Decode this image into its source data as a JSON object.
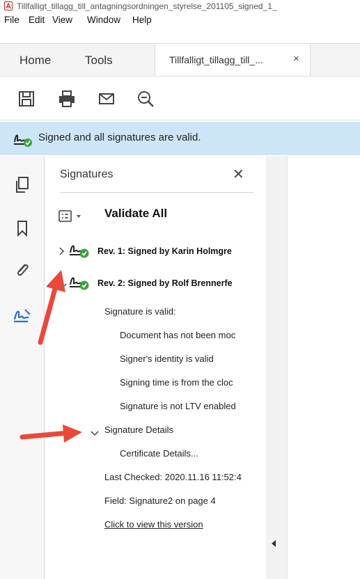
{
  "window": {
    "title": "Tillfalligt_tillagg_till_antagningsordningen_styrelse_201105_signed_1_"
  },
  "menu": [
    "File",
    "Edit",
    "View",
    "Window",
    "Help"
  ],
  "tabs": {
    "home": "Home",
    "tools": "Tools",
    "document": "Tillfalligt_tillagg_till_...",
    "close_glyph": "×"
  },
  "banner": {
    "text": "Signed and all signatures are valid."
  },
  "panel": {
    "heading": "Signatures",
    "close_glyph": "✕",
    "validate_all": "Validate All",
    "revisions": [
      {
        "label": "Rev. 1: Signed by Karin Holmgre"
      },
      {
        "label": "Rev. 2: Signed by Rolf Brennerfe"
      }
    ],
    "details": {
      "valid": "Signature is valid:",
      "not_modified": "Document has not been moc",
      "identity": "Signer's identity is valid",
      "time": "Signing time is from the cloc",
      "ltv": "Signature is not LTV enabled",
      "sig_details": "Signature Details",
      "cert_details": "Certificate Details...",
      "last_checked": "Last Checked: 2020.11.16 11:52:4",
      "field": "Field: Signature2 on page 4",
      "view_version": "Click to view this version"
    }
  },
  "colors": {
    "banner_bg": "#cde6f7",
    "valid_green": "#3ba13b",
    "annotation_red": "#e8493a",
    "rail_active_blue": "#2d6fbf"
  }
}
